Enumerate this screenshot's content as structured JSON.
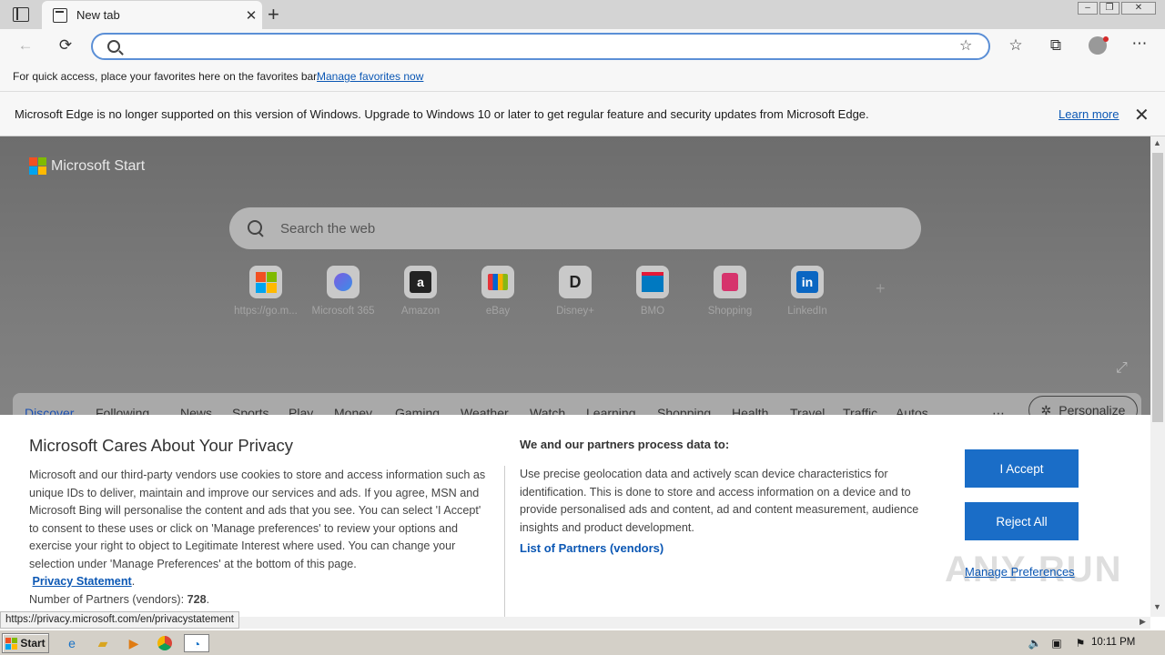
{
  "browser": {
    "tab_title": "New tab",
    "favorites_bar_text": "For quick access, place your favorites here on the favorites bar.",
    "favorites_bar_link": "Manage favorites now",
    "info_message": "Microsoft Edge is no longer supported on this version of Windows. Upgrade to Windows 10 or later to get regular feature and security updates from Microsoft Edge.",
    "info_link": "Learn more",
    "address_value": ""
  },
  "page": {
    "brand": "Microsoft Start",
    "search_placeholder": "Search the web",
    "tiles": [
      {
        "label": "https://go.m...",
        "icon": "microsoft-logo"
      },
      {
        "label": "Microsoft 365",
        "icon": "m365-icon"
      },
      {
        "label": "Amazon",
        "icon": "a"
      },
      {
        "label": "eBay",
        "icon": "bag-icon"
      },
      {
        "label": "Disney+",
        "icon": "D"
      },
      {
        "label": "BMO",
        "icon": "BMO"
      },
      {
        "label": "Shopping",
        "icon": "shopping-bag-icon"
      },
      {
        "label": "LinkedIn",
        "icon": "in"
      }
    ],
    "nav": [
      "Discover",
      "Following",
      "News",
      "Sports",
      "Play",
      "Money",
      "Gaming",
      "Weather",
      "Watch",
      "Learning",
      "Shopping",
      "Health",
      "Travel",
      "Traffic",
      "Autos"
    ],
    "personalize": "Personalize"
  },
  "consent": {
    "title": "Microsoft Cares About Your Privacy",
    "body": "Microsoft and our third-party vendors use cookies to store and access information such as unique IDs to deliver, maintain and improve our services and ads. If you agree, MSN and Microsoft Bing will personalise the content and ads that you see. You can select 'I Accept' to consent to these uses or click on 'Manage preferences' to review your options and exercise your right to object to Legitimate Interest where used.  You can change your selection under 'Manage Preferences' at the bottom of this page.",
    "privacy_link": "Privacy Statement",
    "partners_label": "Number of Partners (vendors):",
    "partners_count": "728",
    "right_heading": "We and our partners process data to:",
    "right_body": "Use precise geolocation data and actively scan device characteristics for identification. This is done to store and access information on a device and to provide personalised ads and content, ad and content measurement, audience insights and product development.",
    "partners_link": "List of Partners (vendors)",
    "accept": "I Accept",
    "reject": "Reject All",
    "manage": "Manage Preferences"
  },
  "status_url": "https://privacy.microsoft.com/en/privacystatement",
  "watermark": "ANY RUN",
  "taskbar": {
    "start": "Start",
    "clock": "10:11 PM"
  },
  "colors": {
    "accent": "#1a6dc7",
    "link": "#0b57b4",
    "omnibox_border": "#5b8fd6"
  }
}
